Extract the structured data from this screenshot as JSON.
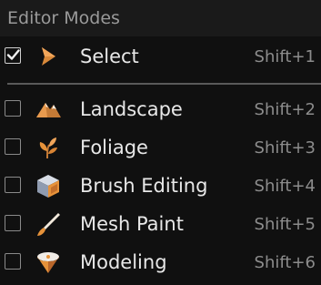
{
  "menu": {
    "header": "Editor Modes",
    "items": [
      {
        "label": "Select",
        "shortcut": "Shift+1",
        "checked": true,
        "icon": "cursor-arrow-icon"
      },
      {
        "label": "Landscape",
        "shortcut": "Shift+2",
        "checked": false,
        "icon": "landscape-mountain-icon"
      },
      {
        "label": "Foliage",
        "shortcut": "Shift+3",
        "checked": false,
        "icon": "foliage-leaves-icon"
      },
      {
        "label": "Brush Editing",
        "shortcut": "Shift+4",
        "checked": false,
        "icon": "brush-cube-icon"
      },
      {
        "label": "Mesh Paint",
        "shortcut": "Shift+5",
        "checked": false,
        "icon": "paint-brush-icon"
      },
      {
        "label": "Modeling",
        "shortcut": "Shift+6",
        "checked": false,
        "icon": "modeling-tool-icon"
      }
    ]
  },
  "colors": {
    "background": "#101010",
    "header_background": "#1a1a1a",
    "label_text": "#e8e8e8",
    "shortcut_text": "#8c8c8c",
    "icon_orange": "#e6923a"
  }
}
